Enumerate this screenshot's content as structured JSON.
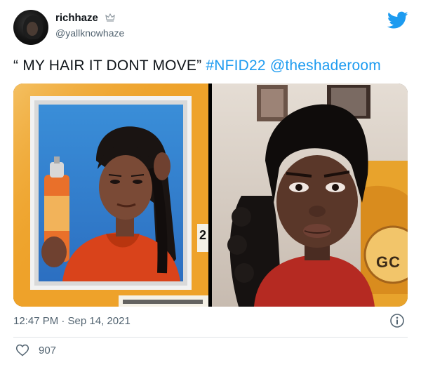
{
  "user": {
    "display_name": "richhaze",
    "badge_icon": "crown-icon",
    "handle": "@yallknowhaze"
  },
  "tweet": {
    "quote_text": "“ MY HAIR IT DONT MOVE”",
    "hashtag": "#NFID22",
    "mention": "@theshaderoom",
    "timestamp": "12:47 PM · Sep 14, 2021",
    "like_count": "907"
  },
  "media": {
    "left_number": "2",
    "right_can_text": "GC"
  },
  "icons": {
    "brand": "twitter-bird-icon",
    "info": "info-icon",
    "like": "heart-icon"
  },
  "colors": {
    "link": "#1d9bf0",
    "muted": "#536471",
    "text": "#0f1419",
    "divider": "#dfe3e6"
  }
}
